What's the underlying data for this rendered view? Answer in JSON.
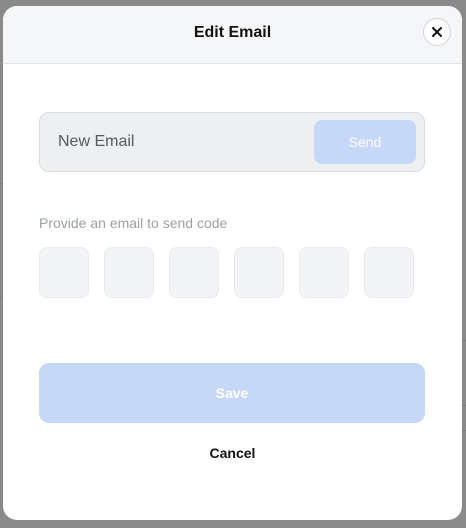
{
  "modal": {
    "title": "Edit Email",
    "close_label": "×"
  },
  "email_field": {
    "value": "",
    "placeholder": "New Email"
  },
  "send_button": {
    "label": "Send"
  },
  "code": {
    "hint": "Provide an email to send code",
    "digits": [
      "",
      "",
      "",
      "",
      "",
      ""
    ]
  },
  "save_button": {
    "label": "Save"
  },
  "cancel_button": {
    "label": "Cancel"
  },
  "colors": {
    "accent_disabled": "#c5d8f7",
    "header_bg": "#f5f6f8",
    "overlay": "#8a8a8a"
  },
  "icons": {
    "close": "close-icon"
  }
}
